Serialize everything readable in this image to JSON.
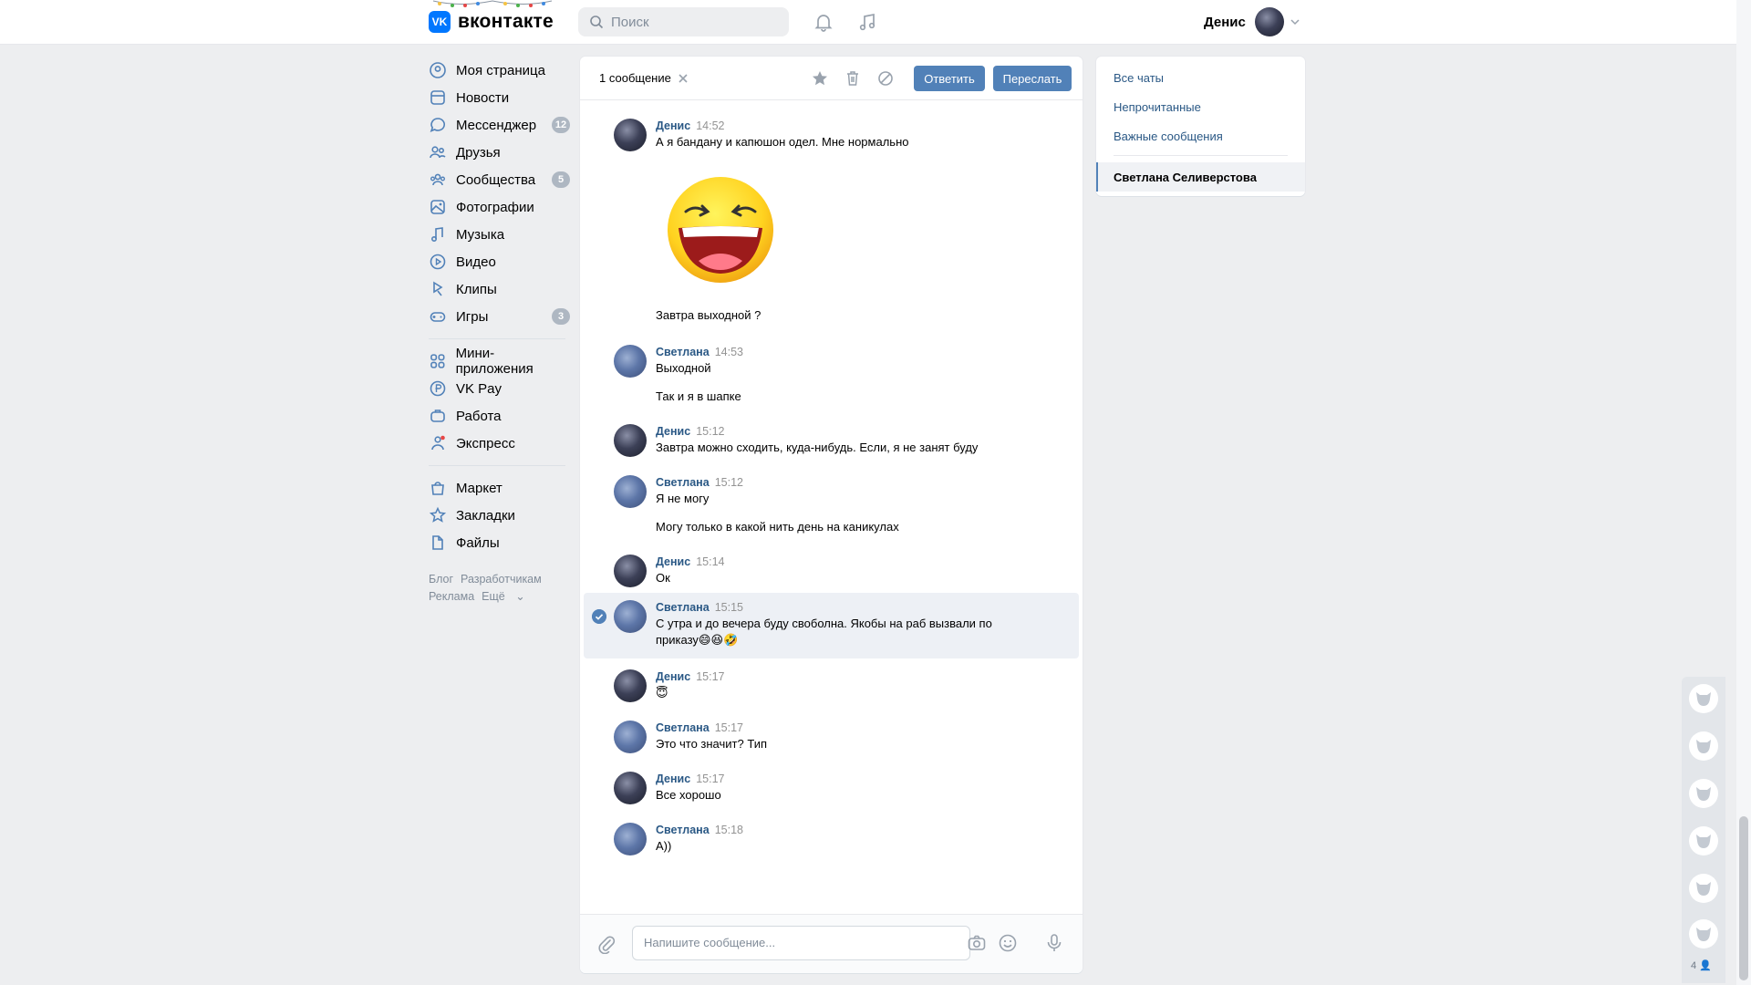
{
  "header": {
    "logo_text": "вконтакте",
    "search_placeholder": "Поиск",
    "user_name": "Денис"
  },
  "nav": {
    "items": [
      {
        "label": "Моя страница",
        "icon": "profile-icon"
      },
      {
        "label": "Новости",
        "icon": "news-icon"
      },
      {
        "label": "Мессенджер",
        "icon": "messenger-icon",
        "badge": "12"
      },
      {
        "label": "Друзья",
        "icon": "friends-icon"
      },
      {
        "label": "Сообщества",
        "icon": "communities-icon",
        "badge": "5"
      },
      {
        "label": "Фотографии",
        "icon": "photos-icon"
      },
      {
        "label": "Музыка",
        "icon": "music-icon"
      },
      {
        "label": "Видео",
        "icon": "video-icon"
      },
      {
        "label": "Клипы",
        "icon": "clips-icon"
      },
      {
        "label": "Игры",
        "icon": "games-icon",
        "badge": "3"
      }
    ],
    "items2": [
      {
        "label": "Мини-приложения",
        "icon": "mini-apps-icon"
      },
      {
        "label": "VK Pay",
        "icon": "vkpay-icon"
      },
      {
        "label": "Работа",
        "icon": "work-icon"
      },
      {
        "label": "Экспресс",
        "icon": "express-icon"
      }
    ],
    "items3": [
      {
        "label": "Маркет",
        "icon": "market-icon"
      },
      {
        "label": "Закладки",
        "icon": "bookmarks-icon"
      },
      {
        "label": "Файлы",
        "icon": "files-icon"
      }
    ],
    "footer": {
      "blog": "Блог",
      "dev": "Разработчикам",
      "ads": "Реклама",
      "more": "Ещё"
    }
  },
  "chat": {
    "selection": "1 сообщение",
    "reply_label": "Ответить",
    "forward_label": "Переслать",
    "composer_placeholder": "Напишите сообщение...",
    "messages": [
      {
        "author": "Денис",
        "time": "14:52",
        "lines": [
          "А я бандану и капюшон одел. Мне нормально"
        ],
        "sticker": "laughing-face-sticker",
        "after": "Завтра выходной ?"
      },
      {
        "author": "Светлана",
        "time": "14:53",
        "lines": [
          "Выходной"
        ],
        "after": "Так и я в шапке"
      },
      {
        "author": "Денис",
        "time": "15:12",
        "lines": [
          "Завтра можно сходить, куда-нибудь. Если, я не занят буду"
        ]
      },
      {
        "author": "Светлана",
        "time": "15:12",
        "lines": [
          "Я не могу"
        ],
        "after": "Могу только в какой нить день на каникулах"
      },
      {
        "author": "Денис",
        "time": "15:14",
        "lines": [
          "Ок"
        ]
      },
      {
        "author": "Светлана",
        "time": "15:15",
        "lines": [
          "С утра и до вечера буду своболна. Якобы на раб вызвали по",
          "приказу😄😆🤣"
        ],
        "selected": true
      },
      {
        "author": "Денис",
        "time": "15:17",
        "lines": [
          "😇"
        ]
      },
      {
        "author": "Светлана",
        "time": "15:17",
        "lines": [
          "Это что значит? Тип"
        ]
      },
      {
        "author": "Денис",
        "time": "15:17",
        "lines": [
          "Все хорошо"
        ]
      },
      {
        "author": "Светлана",
        "time": "15:18",
        "lines": [
          "А))"
        ]
      }
    ]
  },
  "right": {
    "all_chats": "Все чаты",
    "unread": "Непрочитанные",
    "important": "Важные сообщения",
    "active_chat": "Светлана Селиверстова"
  },
  "stickers": {
    "count": "4"
  },
  "colors": {
    "accent": "#5181b8",
    "link": "#2a5885",
    "vk_blue": "#0077ff"
  }
}
